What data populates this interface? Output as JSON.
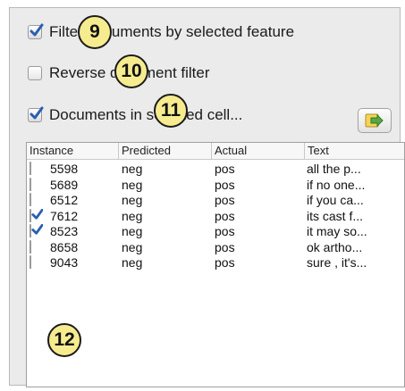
{
  "options": {
    "filter_by_feature": {
      "label": "Filter documents by selected feature",
      "checked": true
    },
    "reverse_filter": {
      "label": "Reverse document filter",
      "checked": false
    },
    "docs_in_cell": {
      "label": "Documents in selected cell...",
      "checked": true
    }
  },
  "badges": [
    "9",
    "10",
    "11",
    "12"
  ],
  "export_button": {
    "icon": "export-arrow-icon"
  },
  "table": {
    "columns": [
      "Instance",
      "Predicted",
      "Actual",
      "Text"
    ],
    "rows": [
      {
        "checked": false,
        "instance": "5598",
        "predicted": "neg",
        "actual": "pos",
        "text": "all the p..."
      },
      {
        "checked": false,
        "instance": "5689",
        "predicted": "neg",
        "actual": "pos",
        "text": "if no one..."
      },
      {
        "checked": false,
        "instance": "6512",
        "predicted": "neg",
        "actual": "pos",
        "text": "if you ca..."
      },
      {
        "checked": true,
        "instance": "7612",
        "predicted": "neg",
        "actual": "pos",
        "text": "its cast f..."
      },
      {
        "checked": true,
        "instance": "8523",
        "predicted": "neg",
        "actual": "pos",
        "text": "it may so..."
      },
      {
        "checked": false,
        "instance": "8658",
        "predicted": "neg",
        "actual": "pos",
        "text": "ok artho..."
      },
      {
        "checked": false,
        "instance": "9043",
        "predicted": "neg",
        "actual": "pos",
        "text": "sure , it's..."
      }
    ]
  },
  "colors": {
    "checkmark": "#2a5fb0",
    "badge_fill": "#f6ec8f",
    "panel_bg": "#ebebeb"
  }
}
